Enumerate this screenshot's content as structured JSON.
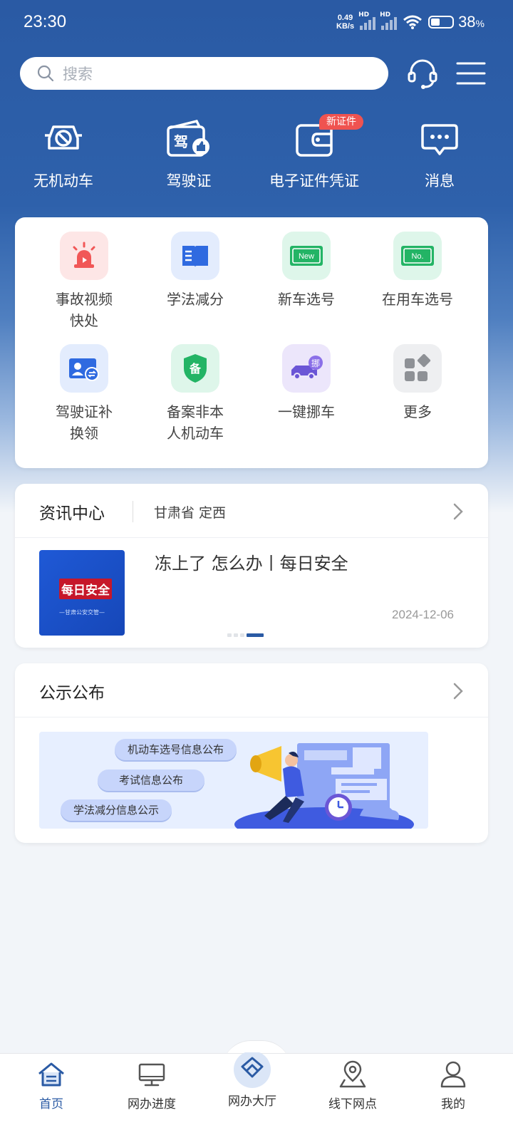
{
  "status_bar": {
    "time": "23:30",
    "net_speed_value": "0.49",
    "net_speed_unit": "KB/s",
    "sim1": "HD",
    "sim2": "HD",
    "battery": "38",
    "battery_unit": "%"
  },
  "search": {
    "placeholder": "搜索"
  },
  "quick": [
    {
      "label": "无机动车",
      "icon": "no-vehicle-icon"
    },
    {
      "label": "驾驶证",
      "icon": "license-icon"
    },
    {
      "label": "电子证件凭证",
      "icon": "wallet-icon",
      "badge": "新证件"
    },
    {
      "label": "消息",
      "icon": "message-icon"
    }
  ],
  "services": [
    {
      "label": "事故视频\n快处",
      "icon": "alarm-icon"
    },
    {
      "label": "学法减分",
      "icon": "book-icon"
    },
    {
      "label": "新车选号",
      "icon": "new-plate-icon",
      "plate_text": "New"
    },
    {
      "label": "在用车选号",
      "icon": "no-plate-icon",
      "plate_text": "No."
    },
    {
      "label": "驾驶证补\n换领",
      "icon": "license-renew-icon"
    },
    {
      "label": "备案非本\n人机动车",
      "icon": "shield-icon",
      "shield_text": "备"
    },
    {
      "label": "一键挪车",
      "icon": "move-car-icon",
      "bubble_text": "挪"
    },
    {
      "label": "更多",
      "icon": "more-icon"
    }
  ],
  "news": {
    "title": "资讯中心",
    "region": "甘肃省 定西",
    "items": [
      {
        "title": "冻上了 怎么办丨每日安全",
        "date": "2024-12-06",
        "thumb_text": "每日安全",
        "thumb_sub": "—甘肃公安交管—"
      }
    ],
    "carousel_total": 4,
    "carousel_active": 4
  },
  "notice": {
    "title": "公示公布",
    "pills": [
      "机动车选号信息公布",
      "考试信息公布",
      "学法减分信息公示"
    ]
  },
  "nav": [
    {
      "label": "首页",
      "icon": "home-icon",
      "active": true
    },
    {
      "label": "网办进度",
      "icon": "monitor-icon",
      "active": false
    },
    {
      "label": "网办大厅",
      "icon": "hall-icon",
      "active": false
    },
    {
      "label": "线下网点",
      "icon": "location-icon",
      "active": false
    },
    {
      "label": "我的",
      "icon": "user-icon",
      "active": false
    }
  ],
  "colors": {
    "brand": "#2a5aa4",
    "badge": "#ef5350",
    "background": "#f2f5f9"
  }
}
